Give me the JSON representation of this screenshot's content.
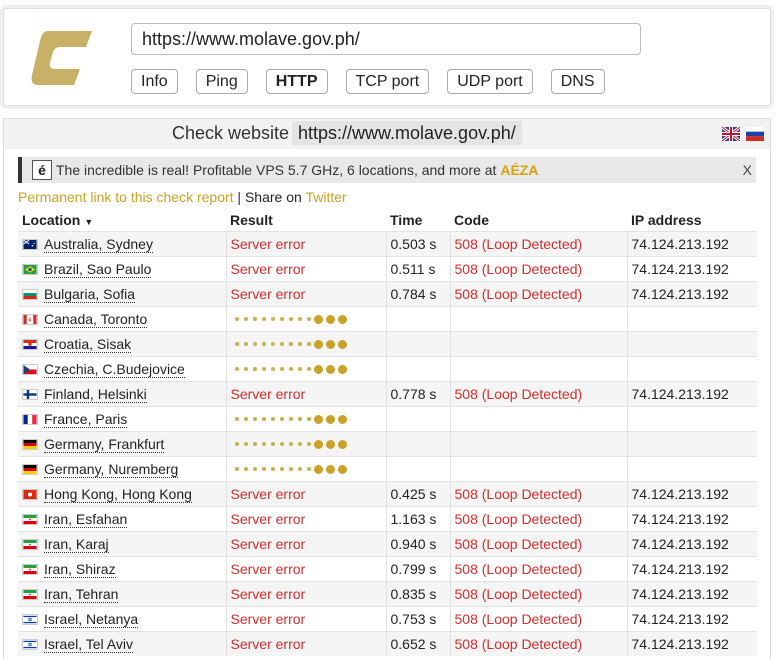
{
  "header": {
    "url_value": "https://www.molave.gov.ph/",
    "tabs": [
      {
        "label": "Info",
        "active": false
      },
      {
        "label": "Ping",
        "active": false
      },
      {
        "label": "HTTP",
        "active": true
      },
      {
        "label": "TCP port",
        "active": false
      },
      {
        "label": "UDP port",
        "active": false
      },
      {
        "label": "DNS",
        "active": false
      }
    ]
  },
  "panel": {
    "title_label": "Check website",
    "title_url": "https://www.molave.gov.ph/"
  },
  "ad": {
    "icon_text": "é",
    "text": "The incredible is real! Profitable VPS 5.7 GHz, 6 locations, and more at ",
    "brand": "AÉZA",
    "close": "X"
  },
  "links": {
    "permanent": "Permanent link to this check report",
    "separator": " | ",
    "share_prefix": "Share on ",
    "twitter": "Twitter"
  },
  "table": {
    "headers": {
      "location": "Location",
      "result": "Result",
      "time": "Time",
      "code": "Code",
      "ip": "IP address"
    },
    "sort_arrow": "▼",
    "rows": [
      {
        "flag": "au",
        "location": "Australia, Sydney",
        "result": "Server error",
        "time": "0.503 s",
        "code": "508 (Loop Detected)",
        "ip": "74.124.213.192"
      },
      {
        "flag": "br",
        "location": "Brazil, Sao Paulo",
        "result": "Server error",
        "time": "0.511 s",
        "code": "508 (Loop Detected)",
        "ip": "74.124.213.192"
      },
      {
        "flag": "bg",
        "location": "Bulgaria, Sofia",
        "result": "Server error",
        "time": "0.784 s",
        "code": "508 (Loop Detected)",
        "ip": "74.124.213.192"
      },
      {
        "flag": "ca",
        "location": "Canada, Toronto",
        "result": "",
        "time": "",
        "code": "",
        "ip": ""
      },
      {
        "flag": "hr",
        "location": "Croatia, Sisak",
        "result": "",
        "time": "",
        "code": "",
        "ip": ""
      },
      {
        "flag": "cz",
        "location": "Czechia, C.Budejovice",
        "result": "",
        "time": "",
        "code": "",
        "ip": ""
      },
      {
        "flag": "fi",
        "location": "Finland, Helsinki",
        "result": "Server error",
        "time": "0.778 s",
        "code": "508 (Loop Detected)",
        "ip": "74.124.213.192"
      },
      {
        "flag": "fr",
        "location": "France, Paris",
        "result": "",
        "time": "",
        "code": "",
        "ip": ""
      },
      {
        "flag": "de",
        "location": "Germany, Frankfurt",
        "result": "",
        "time": "",
        "code": "",
        "ip": ""
      },
      {
        "flag": "de",
        "location": "Germany, Nuremberg",
        "result": "",
        "time": "",
        "code": "",
        "ip": ""
      },
      {
        "flag": "hk",
        "location": "Hong Kong, Hong Kong",
        "result": "Server error",
        "time": "0.425 s",
        "code": "508 (Loop Detected)",
        "ip": "74.124.213.192"
      },
      {
        "flag": "ir",
        "location": "Iran, Esfahan",
        "result": "Server error",
        "time": "1.163 s",
        "code": "508 (Loop Detected)",
        "ip": "74.124.213.192"
      },
      {
        "flag": "ir",
        "location": "Iran, Karaj",
        "result": "Server error",
        "time": "0.940 s",
        "code": "508 (Loop Detected)",
        "ip": "74.124.213.192"
      },
      {
        "flag": "ir",
        "location": "Iran, Shiraz",
        "result": "Server error",
        "time": "0.799 s",
        "code": "508 (Loop Detected)",
        "ip": "74.124.213.192"
      },
      {
        "flag": "ir",
        "location": "Iran, Tehran",
        "result": "Server error",
        "time": "0.835 s",
        "code": "508 (Loop Detected)",
        "ip": "74.124.213.192"
      },
      {
        "flag": "il",
        "location": "Israel, Netanya",
        "result": "Server error",
        "time": "0.753 s",
        "code": "508 (Loop Detected)",
        "ip": "74.124.213.192"
      },
      {
        "flag": "il",
        "location": "Israel, Tel Aviv",
        "result": "Server error",
        "time": "0.652 s",
        "code": "508 (Loop Detected)",
        "ip": "74.124.213.192"
      }
    ]
  },
  "colors": {
    "accent_gold": "#c9a227",
    "error_red": "#d12e2e"
  }
}
